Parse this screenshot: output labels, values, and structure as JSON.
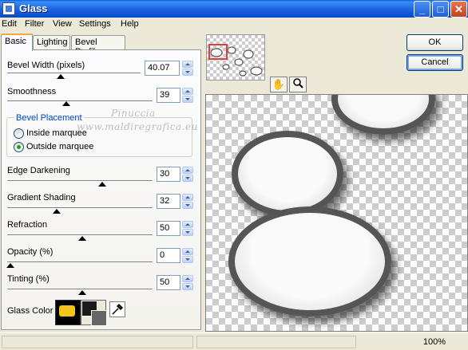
{
  "window": {
    "title": "Glass"
  },
  "menu": [
    "Edit",
    "Filter",
    "View",
    "Settings",
    "Help"
  ],
  "tabs": [
    "Basic",
    "Lighting",
    "Bevel Profile"
  ],
  "controls": {
    "bevel_width": {
      "label": "Bevel Width (pixels)",
      "value": "40.07"
    },
    "smoothness": {
      "label": "Smoothness",
      "value": "39"
    },
    "bevel_placement": {
      "title": "Bevel Placement",
      "options": [
        "Inside marquee",
        "Outside marquee"
      ],
      "selected": "Outside marquee"
    },
    "edge_darkening": {
      "label": "Edge Darkening",
      "value": "30"
    },
    "gradient_shading": {
      "label": "Gradient Shading",
      "value": "32"
    },
    "refraction": {
      "label": "Refraction",
      "value": "50"
    },
    "opacity": {
      "label": "Opacity (%)",
      "value": "0"
    },
    "tinting": {
      "label": "Tinting (%)",
      "value": "50"
    },
    "glass_color": {
      "label": "Glass Color",
      "color": "#F3C519"
    }
  },
  "buttons": {
    "ok": "OK",
    "cancel": "Cancel"
  },
  "watermark": {
    "line1": "Pinuccia",
    "line2": "www.maldiregrafica.eu"
  },
  "status": {
    "zoom": "100%"
  },
  "colors": {
    "titlebar": "#0A50D0",
    "accent": "#F3A93D",
    "group_title": "#0046D5"
  }
}
